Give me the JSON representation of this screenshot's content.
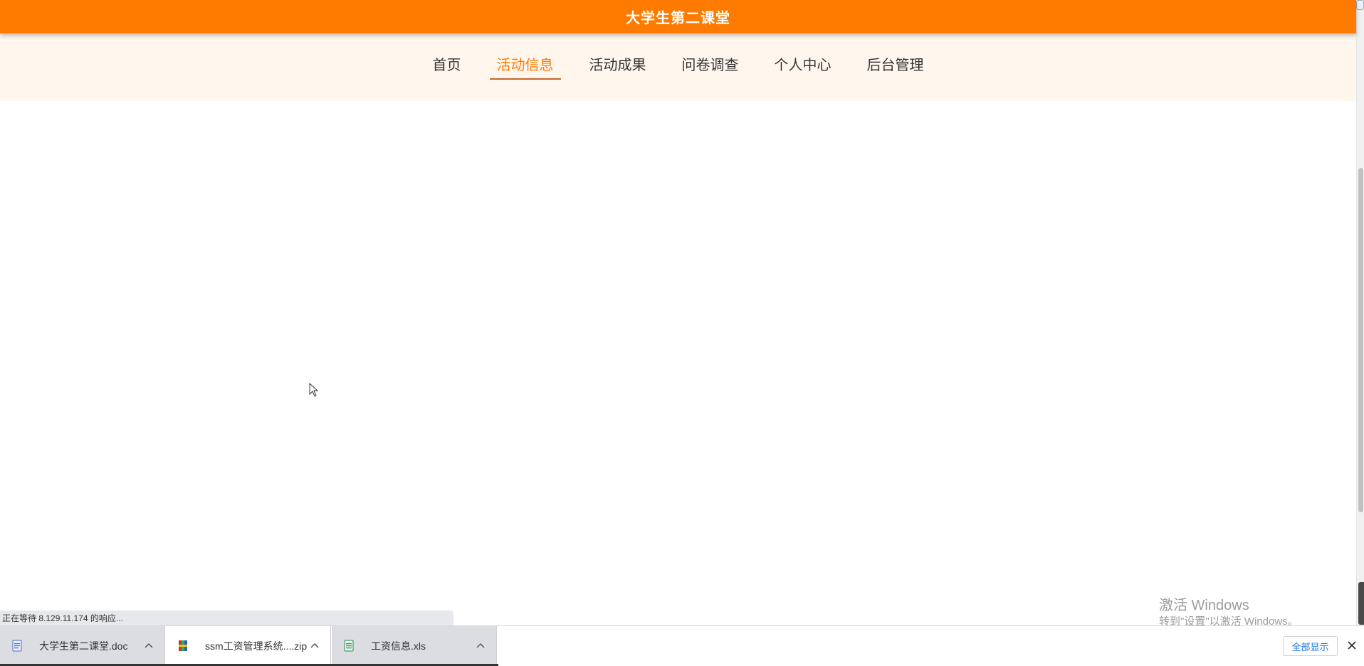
{
  "header": {
    "title": "大学生第二课堂"
  },
  "nav": {
    "items": [
      {
        "label": "首页",
        "active": false
      },
      {
        "label": "活动信息",
        "active": true
      },
      {
        "label": "活动成果",
        "active": false
      },
      {
        "label": "问卷调查",
        "active": false
      },
      {
        "label": "个人中心",
        "active": false
      },
      {
        "label": "后台管理",
        "active": false
      }
    ]
  },
  "status": {
    "text": "正在等待 8.129.11.174 的响应..."
  },
  "watermark": {
    "title": "激活 Windows",
    "subtitle": "转到\"设置\"以激活 Windows。"
  },
  "downloads": {
    "items": [
      {
        "name": "大学生第二课堂.doc",
        "icon": "word-doc-icon"
      },
      {
        "name": "ssm工资管理系统....zip",
        "icon": "zip-archive-icon"
      },
      {
        "name": "工资信息.xls",
        "icon": "excel-xls-icon"
      }
    ],
    "show_all_label": "全部显示"
  },
  "colors": {
    "brand": "#ff7b00",
    "nav_background": "#fff6ee",
    "active_underline": "#c8642a"
  }
}
